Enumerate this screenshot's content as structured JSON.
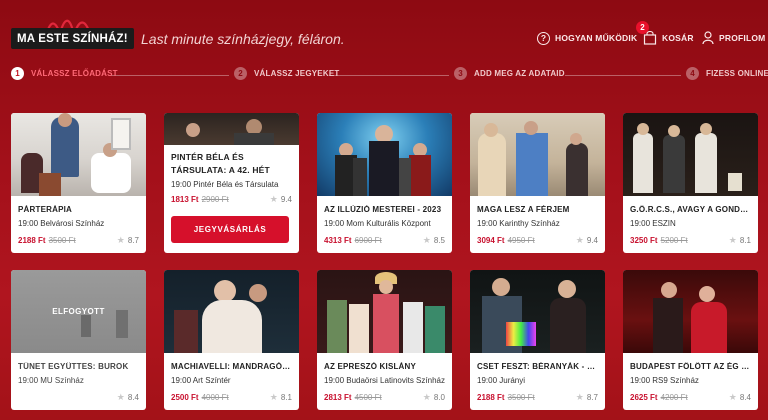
{
  "header": {
    "logo_text": "MA ESTE SZÍNHÁZ!",
    "tagline": "Last minute színházjegy, féláron.",
    "nav": {
      "how_it_works": "HOGYAN MŰKÖDIK",
      "cart": "KOSÁR",
      "cart_count": "2",
      "profile": "PROFILOM"
    }
  },
  "steps": [
    {
      "num": "1",
      "label": "VÁLASSZ ELŐADÁST"
    },
    {
      "num": "2",
      "label": "VÁLASSZ JEGYEKET"
    },
    {
      "num": "3",
      "label": "ADD MEG AZ ADATAID"
    },
    {
      "num": "4",
      "label": "FIZESS ONLINE"
    }
  ],
  "shows": [
    {
      "title": "PÁRTERÁPIA",
      "venue": "19:00 Belvárosi Színház",
      "price": "2188 Ft",
      "old_price": "3500 Ft",
      "rating": "8.7"
    },
    {
      "title": "PINTÉR BÉLA ÉS TÁRSULATA: A 42. HÉT",
      "venue": "19:00 Pintér Béla és Társulata",
      "price": "1813 Ft",
      "old_price": "2900 Ft",
      "rating": "9.4",
      "button": "JEGYVÁSÁRLÁS"
    },
    {
      "title": "AZ ILLÚZIÓ MESTEREI - 2023",
      "venue": "19:00 Mom Kulturális Központ",
      "price": "4313 Ft",
      "old_price": "6900 Ft",
      "rating": "8.5"
    },
    {
      "title": "MAGA LESZ A FÉRJEM",
      "venue": "19:00 Karinthy Színház",
      "price": "3094 Ft",
      "old_price": "4950 Ft",
      "rating": "9.4"
    },
    {
      "title": "G.Ö.R.C.S., AVAGY A GONDVISELÉS",
      "venue": "19:00 ESZIN",
      "price": "3250 Ft",
      "old_price": "5200 Ft",
      "rating": "8.1"
    },
    {
      "title": "TÜNET EGYÜTTES: BUROK",
      "venue": "19:00 MU Színház",
      "price": "",
      "old_price": "",
      "rating": "8.4",
      "status": "ELFOGYOTT"
    },
    {
      "title": "MACHIAVELLI: MANDRAGÓRA",
      "venue": "19:00 Art Színtér",
      "price": "2500 Ft",
      "old_price": "4000 Ft",
      "rating": "8.1"
    },
    {
      "title": "AZ EPRESZÓ KISLÁNY",
      "venue": "19:00 Budaörsi Latinovits Színház",
      "price": "2813 Ft",
      "old_price": "4500 Ft",
      "rating": "8.0"
    },
    {
      "title": "CSET FESZT: BÉRANYÁK - VÍGJÁTÉK",
      "venue": "19:00 Jurányi",
      "price": "2188 Ft",
      "old_price": "3500 Ft",
      "rating": "8.7"
    },
    {
      "title": "BUDAPEST FÖLÖTT AZ ÉG - A MUSICAL",
      "venue": "19:00 RS9 Színház",
      "price": "2625 Ft",
      "old_price": "4200 Ft",
      "rating": "8.4"
    }
  ],
  "colors": {
    "accent": "#d6102b",
    "background": "#a3101a",
    "price": "#c8102e"
  }
}
